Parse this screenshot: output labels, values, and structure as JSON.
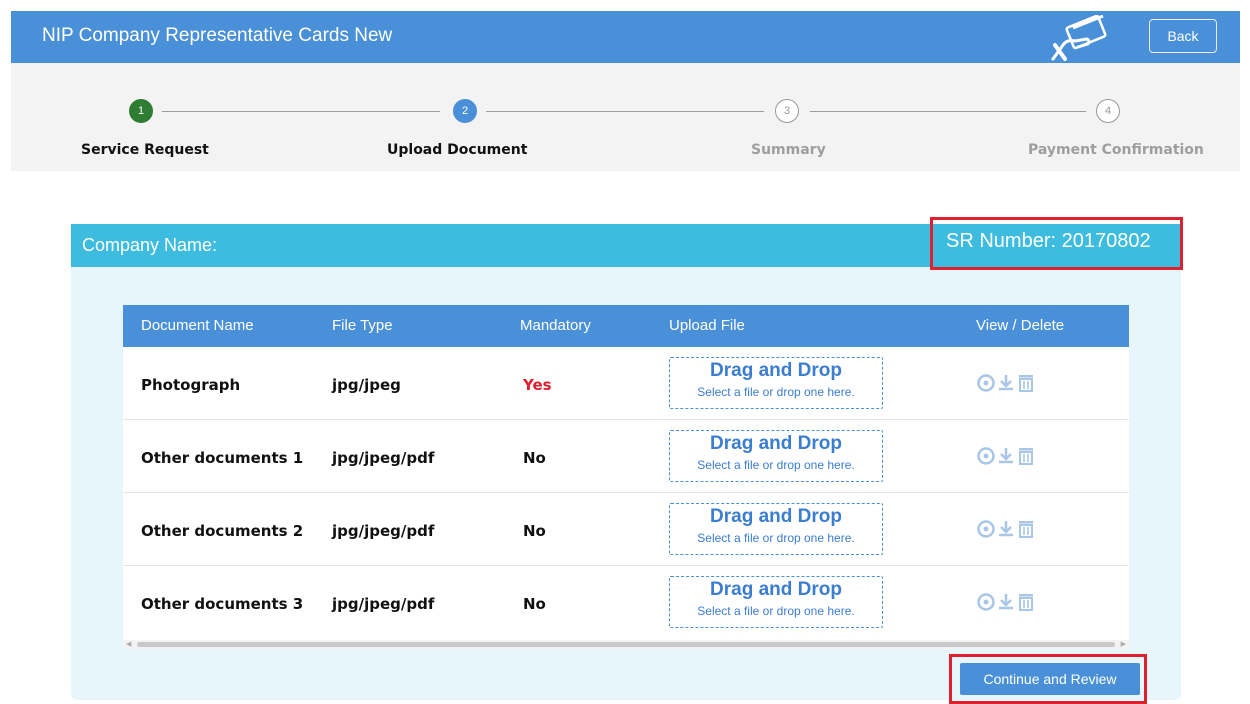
{
  "header": {
    "title": "NIP Company Representative Cards New",
    "card_icon": "card-in-hand-icon",
    "back_label": "Back"
  },
  "stepper": {
    "steps": [
      {
        "number": "1",
        "label": "Service Request",
        "state": "done"
      },
      {
        "number": "2",
        "label": "Upload Document",
        "state": "active"
      },
      {
        "number": "3",
        "label": "Summary",
        "state": "todo"
      },
      {
        "number": "4",
        "label": "Payment Confirmation",
        "state": "todo"
      }
    ]
  },
  "card": {
    "company_label": "Company Name:",
    "sr_label": "SR Number: 20170802"
  },
  "table": {
    "headers": [
      "Document Name",
      "File Type",
      "Mandatory",
      "Upload File",
      "View / Delete"
    ],
    "rows": [
      {
        "name": "Photograph",
        "file_type": "jpg/jpeg",
        "mandatory": "Yes"
      },
      {
        "name": "Other documents 1",
        "file_type": "jpg/jpeg/pdf",
        "mandatory": "No"
      },
      {
        "name": "Other documents 2",
        "file_type": "jpg/jpeg/pdf",
        "mandatory": "No"
      },
      {
        "name": "Other documents 3",
        "file_type": "jpg/jpeg/pdf",
        "mandatory": "No"
      }
    ],
    "dropzone_title": "Drag and Drop",
    "dropzone_sub": "Select a file or drop one here.",
    "action_icons": [
      "view-icon",
      "download-icon",
      "delete-icon"
    ]
  },
  "footer": {
    "continue_label": "Continue and Review"
  },
  "colors": {
    "header_bg": "#4a90d9",
    "card_head_bg": "#3dbcdf",
    "card_bg": "#e6f6fb",
    "highlight_border": "#e0202e",
    "mandatory_yes": "#e0202e",
    "step_done": "#2e7d32"
  }
}
